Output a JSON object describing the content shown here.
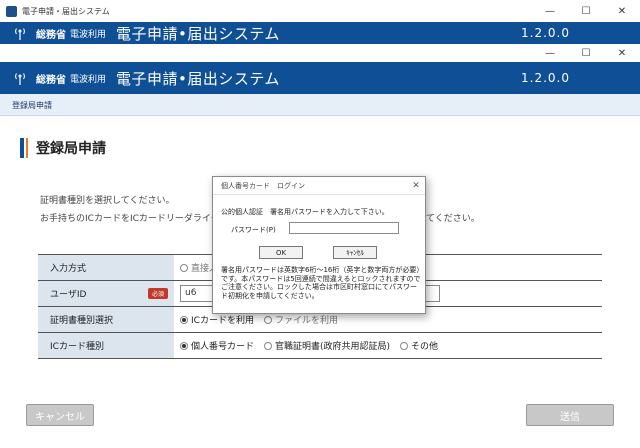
{
  "back_window": {
    "title": "電子申請・届出システム",
    "ministry": "総務省",
    "usage": "電波利用",
    "system_name": "電子申請•届出システム",
    "version": "1.2.0.0"
  },
  "window": {
    "ministry": "総務省",
    "usage": "電波利用",
    "system_name": "電子申請•届出システム",
    "version": "1.2.0.0",
    "breadcrumb": "登録局申請",
    "heading": "登録局申請",
    "instruction1": "証明書種別を選択してください。",
    "instruction2": "お手持ちのICカードをICカードリーダライタ",
    "instruction2_tail": "てください。",
    "form": {
      "input_method": {
        "label": "入力方式",
        "option1": "直接入"
      },
      "user_id": {
        "label": "ユーザID",
        "required": "必須",
        "value": "u6"
      },
      "cert_type": {
        "label": "証明書種別選択",
        "opt_ic": "ICカードを利用",
        "opt_file": "ファイルを利用"
      },
      "ic_type": {
        "label": "ICカード種別",
        "opt_personal": "個人番号カード",
        "opt_govt": "官職証明書(政府共用認証局)",
        "opt_other": "その他"
      }
    },
    "cancel_button": "キャンセル",
    "send_button": "送信"
  },
  "dialog": {
    "title": "個人番号カード　ログイン",
    "message": "公的個人認証　署名用パスワードを入力して下さい。",
    "password_label": "パスワード(P)",
    "ok": "OK",
    "cancel": "ｷｬﾝｾﾙ",
    "note": "署名用パスワードは英数字6桁～16桁（英字と数字両方が必要）です。本パスワードは5回連続で間違えるとロックされますのでご注意ください。ロックした場合は市区町村窓口にてパスワード初期化を申請してください。"
  },
  "colors": {
    "banner": "#0f4f95",
    "accent": "#e97d1f",
    "required": "#c0392b"
  }
}
